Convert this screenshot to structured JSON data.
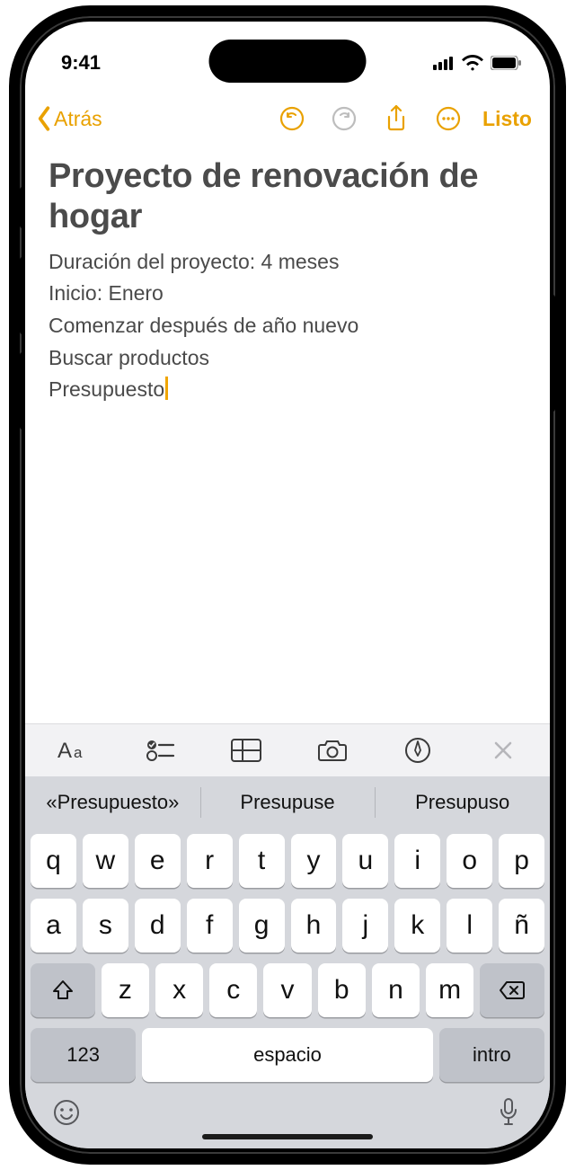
{
  "status": {
    "time": "9:41"
  },
  "nav": {
    "back_label": "Atrás",
    "done_label": "Listo"
  },
  "note": {
    "title": "Proyecto de renovación de hogar",
    "lines": [
      "Duración del proyecto: 4 meses",
      "Inicio: Enero",
      "Comenzar después de año nuevo",
      "Buscar productos",
      "Presupuesto"
    ]
  },
  "suggestions": [
    "«Presupuesto»",
    "Presupuse",
    "Presupuso"
  ],
  "keyboard": {
    "row1": [
      "q",
      "w",
      "e",
      "r",
      "t",
      "y",
      "u",
      "i",
      "o",
      "p"
    ],
    "row2": [
      "a",
      "s",
      "d",
      "f",
      "g",
      "h",
      "j",
      "k",
      "l",
      "ñ"
    ],
    "row3": [
      "z",
      "x",
      "c",
      "v",
      "b",
      "n",
      "m"
    ],
    "num_label": "123",
    "space_label": "espacio",
    "enter_label": "intro"
  },
  "colors": {
    "accent": "#e9a100"
  }
}
